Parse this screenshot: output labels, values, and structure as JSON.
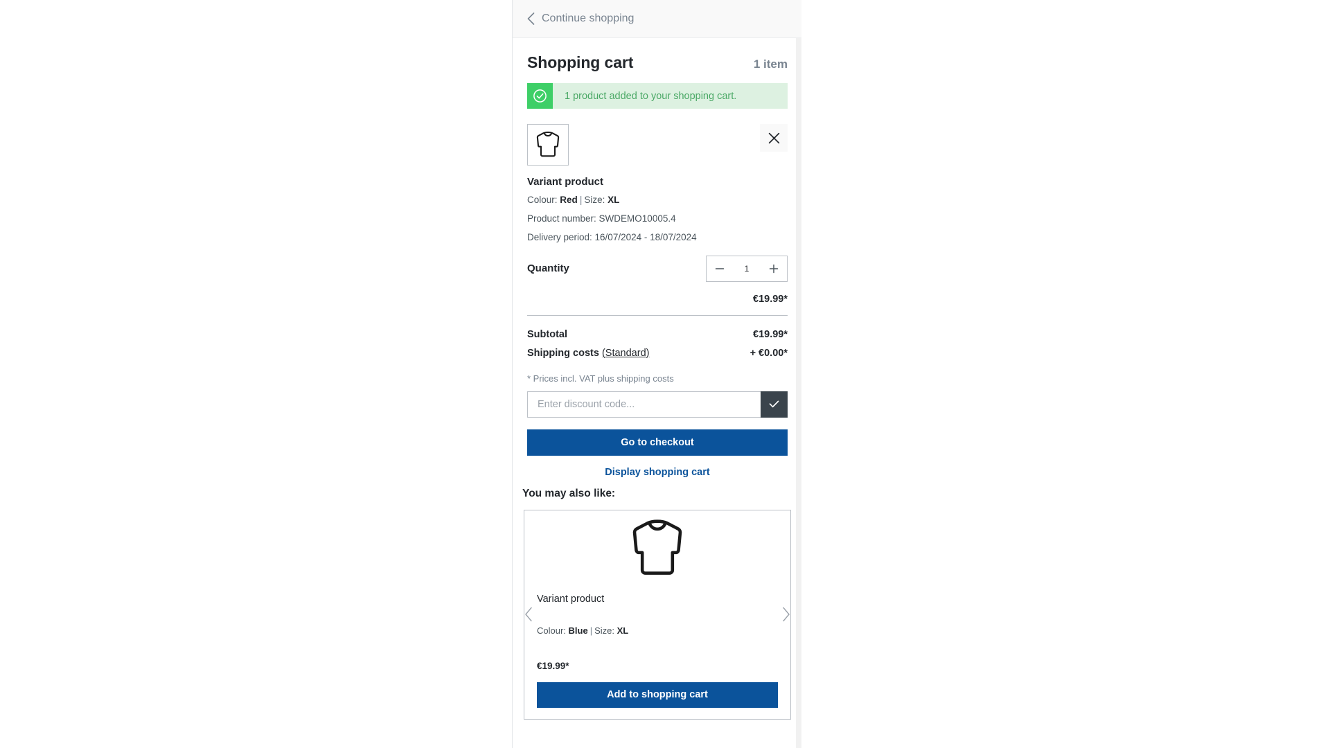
{
  "colors": {
    "brand_blue": "#0b539b",
    "success_green": "#3ecf67",
    "success_bg": "#ddf1e1",
    "success_text": "#4aa865",
    "dark": "#23272c",
    "muted": "#798490",
    "border": "#bcc1c7",
    "header_bg": "#f9f9f9",
    "submit_dark": "#3a444c"
  },
  "header": {
    "back_label": "Continue shopping",
    "back_icon": "chevron-left-icon"
  },
  "cart": {
    "title": "Shopping cart",
    "item_count": "1 item",
    "alert": {
      "icon": "check-circle-icon",
      "message": "1 product added to your shopping cart."
    },
    "line_item": {
      "image_icon": "shirt-icon",
      "remove_icon": "close-icon",
      "name": "Variant product",
      "variant_prefix": "Colour:",
      "variant_colour": "Red",
      "variant_separator": "|",
      "size_prefix": "Size:",
      "variant_size": "XL",
      "product_number": "Product number: SWDEMO10005.4",
      "delivery_period": "Delivery period: 16/07/2024 - 18/07/2024",
      "quantity_label": "Quantity",
      "quantity_value": "1",
      "quantity_decrease_icon": "minus-icon",
      "quantity_increase_icon": "plus-icon",
      "price": "€19.99*"
    },
    "summary": {
      "subtotal_label": "Subtotal",
      "subtotal_value": "€19.99*",
      "shipping_label": "Shipping costs",
      "shipping_option": "(Standard)",
      "shipping_value": "+ €0.00*",
      "vat_note": "* Prices incl. VAT plus shipping costs"
    },
    "discount": {
      "placeholder": "Enter discount code...",
      "value": "",
      "submit_icon": "check-icon"
    },
    "actions": {
      "checkout_label": "Go to checkout",
      "display_cart_label": "Display shopping cart"
    }
  },
  "cross_selling": {
    "title": "You may also like:",
    "prev_icon": "chevron-left-icon",
    "next_icon": "chevron-right-icon",
    "product": {
      "image_icon": "shirt-icon",
      "name": "Variant product",
      "variant_prefix": "Colour:",
      "variant_colour": "Blue",
      "variant_separator": "|",
      "size_prefix": "Size:",
      "variant_size": "XL",
      "price": "€19.99*",
      "add_button_label": "Add to shopping cart"
    }
  }
}
